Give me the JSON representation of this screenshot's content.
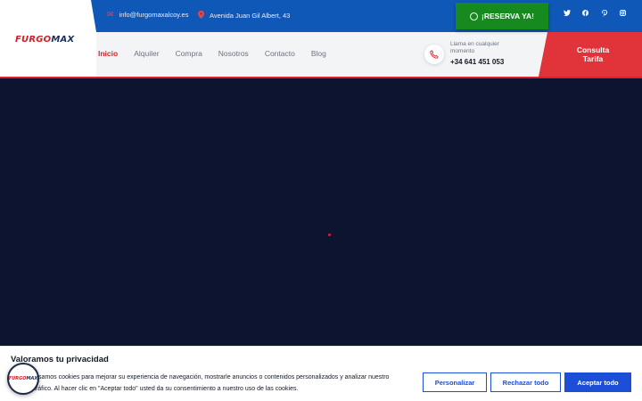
{
  "topbar": {
    "email": "info@furgomaxalcoy.es",
    "address": "Avenida Juan Gil Albert, 43",
    "social_icons": [
      "twitter-icon",
      "facebook-icon",
      "pinterest-icon",
      "instagram-icon"
    ]
  },
  "reserve_button": {
    "label": "¡RESERVA YA!"
  },
  "logo": {
    "part1": "FURGO",
    "part2": "MAX"
  },
  "nav": {
    "items": [
      "Inicio",
      "Alquiler",
      "Compra",
      "Nosotros",
      "Contacto",
      "Blog"
    ],
    "active": "Inicio"
  },
  "call": {
    "label": "Llama en cualquier momento",
    "number": "+34 641 451 053"
  },
  "tarifa_button": {
    "line1": "Consulta",
    "line2": "Tarifa"
  },
  "cookie": {
    "title": "Valoramos tu privacidad",
    "text": "Usamos cookies para mejorar su experiencia de navegación, mostrarle anuncios o contenidos personalizados y analizar nuestro tráfico. Al hacer clic en \"Aceptar todo\" usted da su consentimiento a nuestro uso de las cookies.",
    "buttons": {
      "customize": "Personalizar",
      "reject": "Rechazar todo",
      "accept": "Aceptar todo"
    }
  },
  "colors": {
    "topbar": "#0f58b7",
    "accent_red": "#e11d2a",
    "whatsapp_green": "#168a1f",
    "hero_bg": "#0c1430",
    "cookie_blue": "#1d4ed8"
  }
}
